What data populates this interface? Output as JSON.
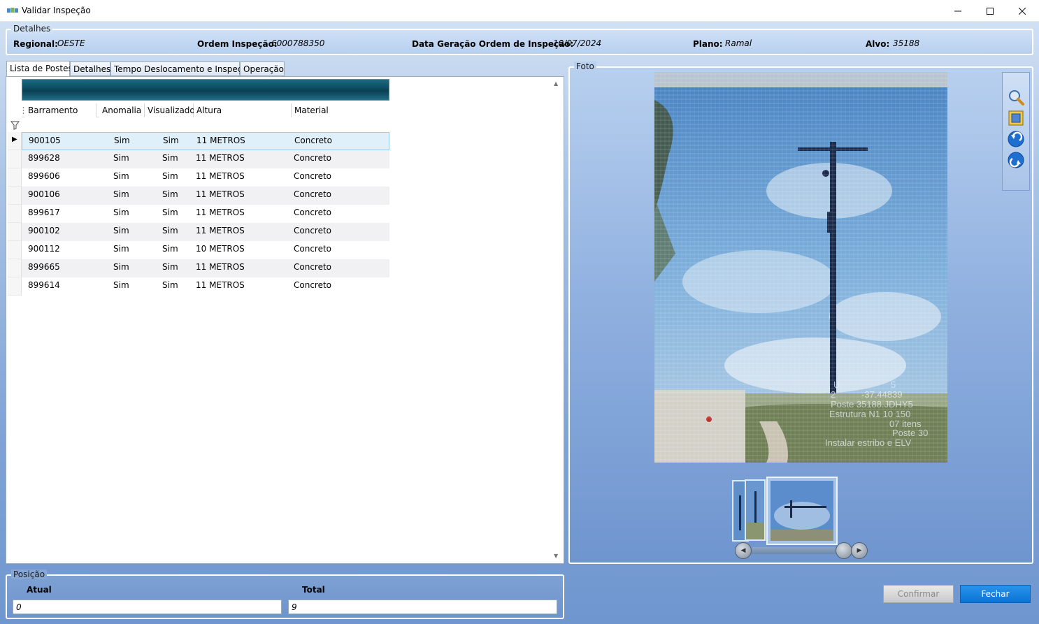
{
  "window": {
    "title": "Validar Inspeção",
    "min": "—",
    "max": "☐",
    "close": "✕"
  },
  "details": {
    "legend": "Detalhes",
    "regional_label": "Regional:",
    "regional_value": "OESTE",
    "ordem_label": "Ordem Inspeção:",
    "ordem_value": "6000788350",
    "data_label": "Data Geração Ordem de Inspeção:",
    "data_value": "10/07/2024",
    "plano_label": "Plano:",
    "plano_value": "Ramal",
    "alvo_label": "Alvo:",
    "alvo_value": "35188"
  },
  "tabs": [
    "Lista de Postes",
    "Detalhes",
    "Tempo Deslocamento e Inspeção",
    "Operação"
  ],
  "grid": {
    "columns": [
      "Barramento",
      "Anomalia",
      "Visualizado",
      "Altura",
      "Material"
    ],
    "rows": [
      [
        "900105",
        "Sim",
        "Sim",
        "11 METROS",
        "Concreto"
      ],
      [
        "899628",
        "Sim",
        "Sim",
        "11 METROS",
        "Concreto"
      ],
      [
        "899606",
        "Sim",
        "Sim",
        "11 METROS",
        "Concreto"
      ],
      [
        "900106",
        "Sim",
        "Sim",
        "11 METROS",
        "Concreto"
      ],
      [
        "899617",
        "Sim",
        "Sim",
        "11 METROS",
        "Concreto"
      ],
      [
        "900102",
        "Sim",
        "Sim",
        "11 METROS",
        "Concreto"
      ],
      [
        "900112",
        "Sim",
        "Sim",
        "10 METROS",
        "Concreto"
      ],
      [
        "899665",
        "Sim",
        "Sim",
        "11 METROS",
        "Concreto"
      ],
      [
        "899614",
        "Sim",
        "Sim",
        "11 METROS",
        "Concreto"
      ]
    ]
  },
  "foto": {
    "legend": "Foto",
    "photo_overlay": [
      "U",
      "5",
      "2",
      "-37.44839",
      "Poste 35188.JDHY5",
      "Estrutura N1 10 150",
      "07 itens",
      "Poste 30",
      "Instalar estribo e ELV"
    ]
  },
  "posicao": {
    "legend": "Posição",
    "atual_label": "Atual",
    "atual_value": "0",
    "total_label": "Total",
    "total_value": "9"
  },
  "buttons": {
    "confirm": "Confirmar",
    "close": "Fechar"
  }
}
